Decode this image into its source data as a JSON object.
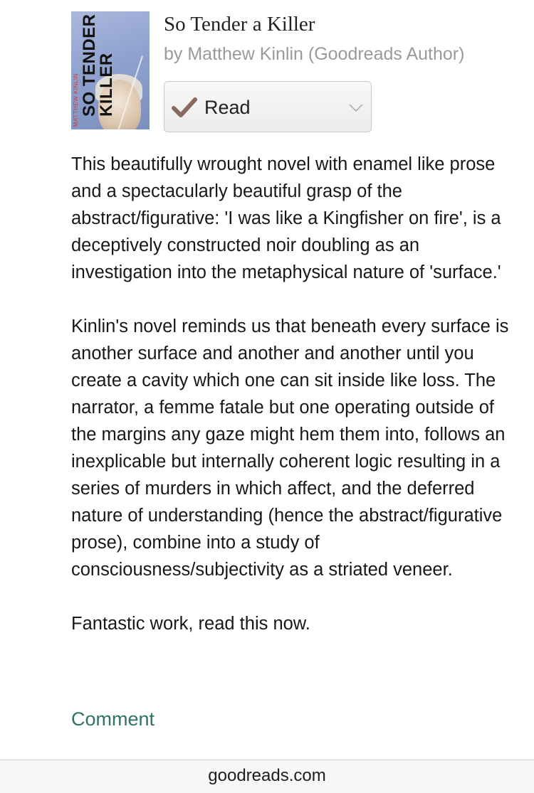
{
  "book": {
    "title": "So Tender a Killer",
    "author": "by Matthew Kinlin (Goodreads Author)",
    "cover": {
      "title_line1": "SO TENDER A",
      "title_line2": "KILLER",
      "author": "MATTHEW KINLIN"
    },
    "shelf_label": "Read"
  },
  "review": {
    "paragraphs": [
      "This beautifully wrought novel with enamel like prose and a spectacularly beautiful grasp of the abstract/figurative: 'I was like a Kingfisher on fire', is a deceptively constructed noir doubling as an investigation into the metaphysical nature of 'surface.'",
      "Kinlin's novel reminds us that beneath every surface is another surface and another and another until you create a cavity which one can sit inside like loss. The narrator, a femme fatale but one operating outside of the margins any gaze might hem them into, follows an inexplicable but internally coherent logic resulting in a series of murders in which affect, and the deferred nature of understanding (hence the abstract/figurative prose), combine into a study of consciousness/subjectivity as a striated veneer.",
      "Fantastic work, read this now."
    ]
  },
  "actions": {
    "comment_label": "Comment"
  },
  "browser": {
    "url": "goodreads.com"
  },
  "colors": {
    "link": "#2f7266",
    "check": "#8a6a5c",
    "author_text": "#9a9a9a"
  },
  "icons": {
    "shelf_status": "check-icon",
    "shelf_dropdown": "chevron-down-icon"
  }
}
